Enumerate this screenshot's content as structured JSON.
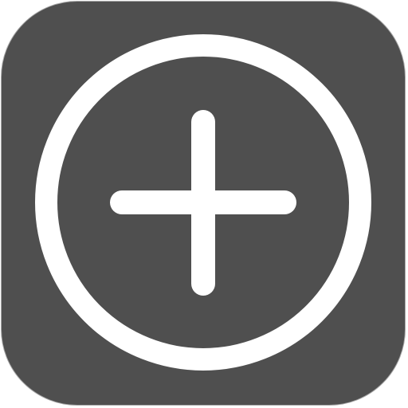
{
  "app_icon": {
    "icon_name": "add-circle-icon",
    "colors": {
      "background": "#4f4f4f",
      "border": "#a9a9a9",
      "foreground": "#ffffff"
    }
  }
}
